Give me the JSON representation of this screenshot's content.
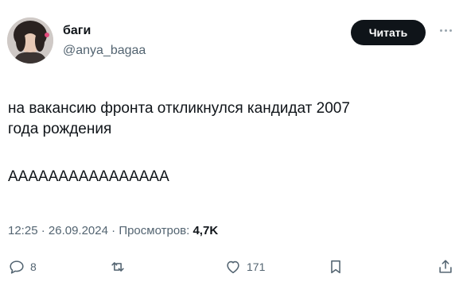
{
  "author": {
    "name": "баги",
    "handle": "@anya_bagaa"
  },
  "follow_button_label": "Читать",
  "more_icon": "more-icon",
  "tweet": {
    "line1": "на вакансию фронта откликнулся кандидат 2007",
    "line2": "года рождения",
    "line3": "АААААААААААААААА"
  },
  "meta": {
    "time": "12:25",
    "separator1": " · ",
    "date": "26.09.2024",
    "separator2": " · ",
    "views_label": "Просмотров:",
    "views_count": "4,7K"
  },
  "actions": {
    "reply_count": "8",
    "retweet_count": "",
    "like_count": "171"
  },
  "colors": {
    "text": "#0f1419",
    "secondary": "#536471",
    "button_bg": "#0f1419"
  }
}
